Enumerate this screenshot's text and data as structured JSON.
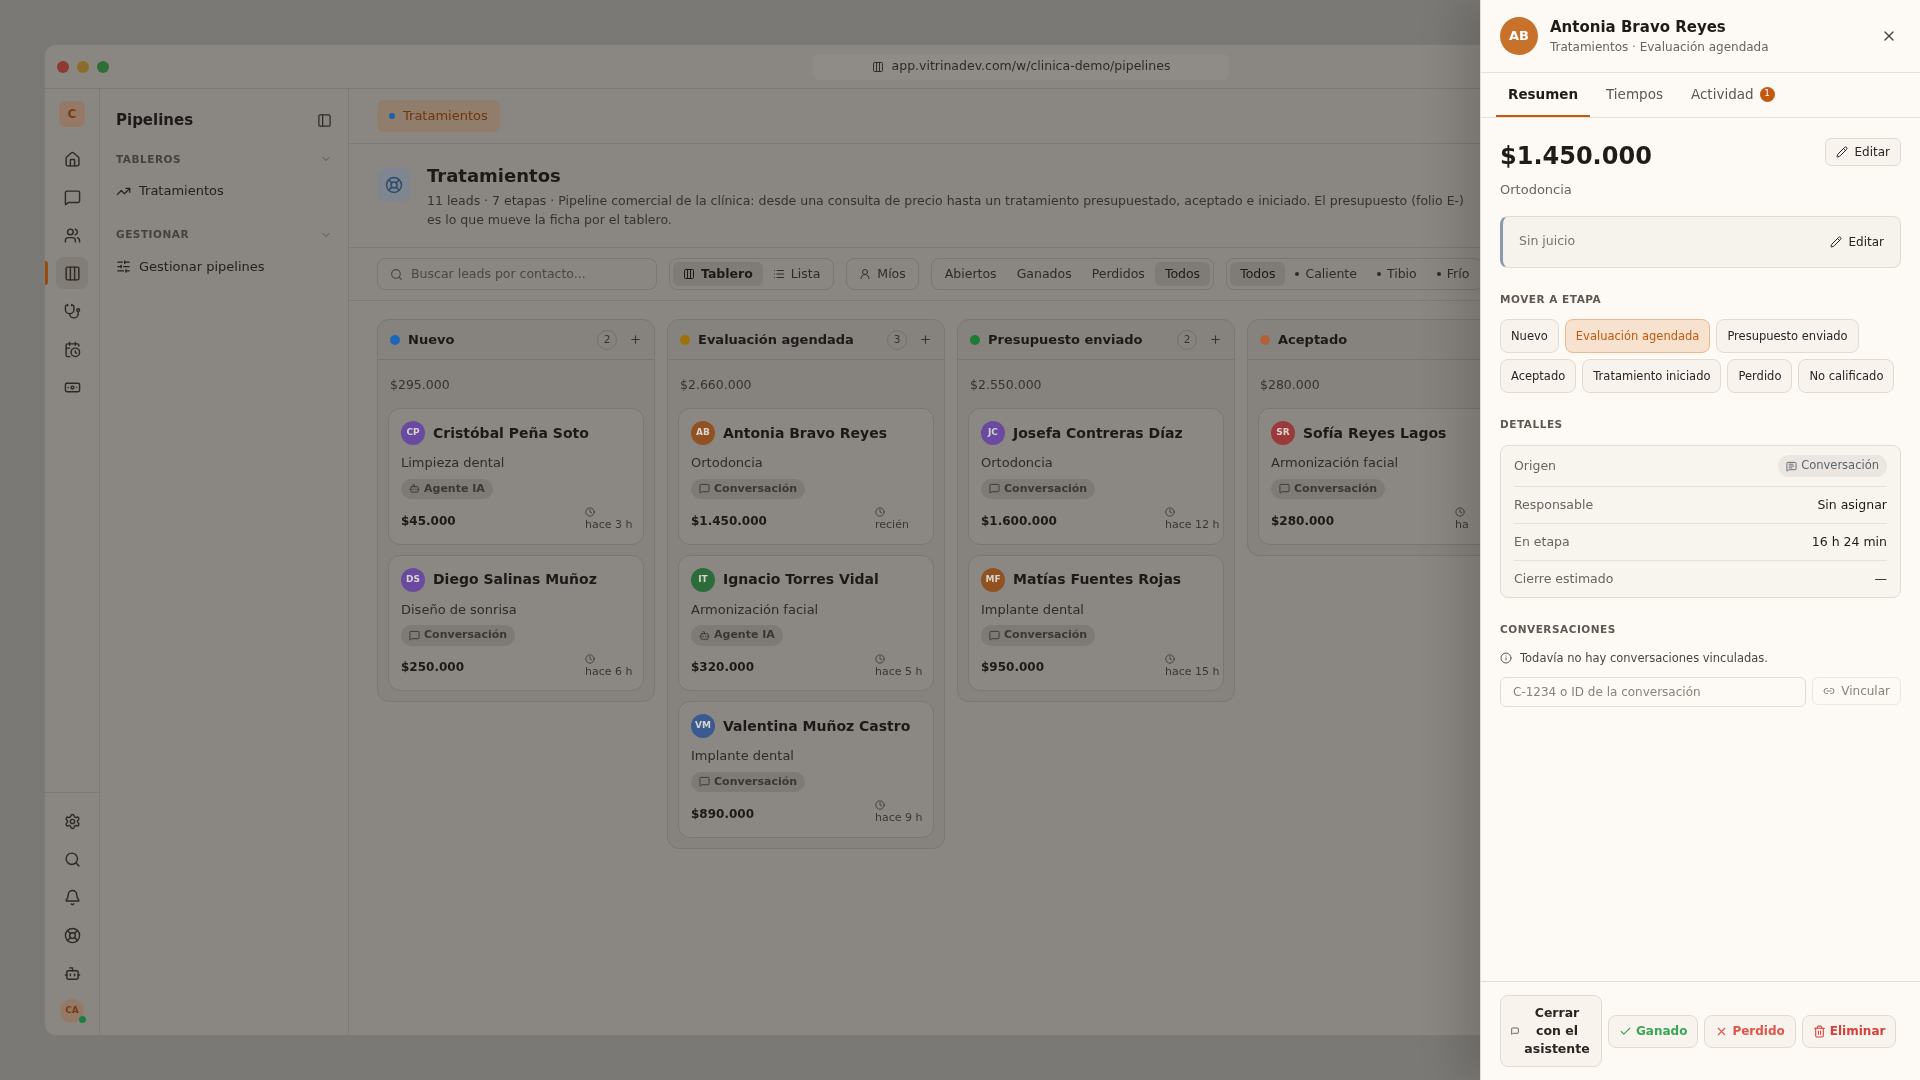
{
  "window": {
    "url": "app.vitrinadev.com/w/clinica-demo/pipelines"
  },
  "rail": {
    "logo": "C",
    "items": [
      {
        "kind": "home",
        "selected": false
      },
      {
        "kind": "chat",
        "selected": false
      },
      {
        "kind": "users",
        "selected": false
      },
      {
        "kind": "board",
        "selected": true
      },
      {
        "kind": "stethoscope",
        "selected": false
      },
      {
        "kind": "calendar",
        "selected": false
      },
      {
        "kind": "money",
        "selected": false
      }
    ],
    "bottom": [
      {
        "kind": "settings"
      },
      {
        "kind": "search"
      },
      {
        "kind": "bell"
      },
      {
        "kind": "help"
      },
      {
        "kind": "bot"
      }
    ],
    "avatar": "CA",
    "online": true
  },
  "sidebar": {
    "title": "Pipelines",
    "sections": [
      {
        "title": "TABLEROS",
        "items": [
          {
            "label": "Tratamientos",
            "kind": "trend"
          }
        ]
      },
      {
        "title": "GESTIONAR",
        "items": [
          {
            "label": "Gestionar pipelines",
            "kind": "sliders"
          }
        ]
      }
    ]
  },
  "tab_chip": "Tratamientos",
  "pipeline": {
    "title": "Tratamientos",
    "description": "11 leads · 7 etapas · Pipeline comercial de la clínica: desde una consulta de precio hasta un tratamiento presupuestado, aceptado e iniciado. El presupuesto (folio E-) es lo que mueve la ficha por el tablero."
  },
  "toolbar": {
    "search_placeholder": "Buscar leads por contacto...",
    "views": [
      {
        "label": "Tablero",
        "kind": "board",
        "selected": true
      },
      {
        "label": "Lista",
        "kind": "list",
        "selected": false
      }
    ],
    "mine": "Míos",
    "status_filters": [
      {
        "label": "Abiertos",
        "selected": false
      },
      {
        "label": "Ganados",
        "selected": false
      },
      {
        "label": "Perdidos",
        "selected": false
      },
      {
        "label": "Todos",
        "selected": true
      }
    ],
    "temperature_filters": [
      {
        "label": "Todos",
        "selected": true,
        "dot": false
      },
      {
        "label": "Caliente",
        "selected": false,
        "dot": true
      },
      {
        "label": "Tibio",
        "selected": false,
        "dot": true
      },
      {
        "label": "Frío",
        "selected": false,
        "dot": true
      }
    ]
  },
  "columns": [
    {
      "name": "Nuevo",
      "color": "#1f66b8",
      "count": "2",
      "total": "$295.000",
      "cards": [
        {
          "initials": "CP",
          "color": "#6a4aa0",
          "name": "Cristóbal Peña Soto",
          "treatment": "Limpieza dental",
          "source": "Agente IA",
          "kind": "agent",
          "amount": "$45.000",
          "time": "hace 3 h"
        },
        {
          "initials": "DS",
          "color": "#6a4aa0",
          "name": "Diego Salinas Muñoz",
          "treatment": "Diseño de sonrisa",
          "source": "Conversación",
          "kind": "chat",
          "amount": "$250.000",
          "time": "hace 6 h"
        }
      ]
    },
    {
      "name": "Evaluación agendada",
      "color": "#a0700a",
      "count": "3",
      "total": "$2.660.000",
      "cards": [
        {
          "initials": "AB",
          "color": "#8f5220",
          "name": "Antonia Bravo Reyes",
          "treatment": "Ortodoncia",
          "source": "Conversación",
          "kind": "chat",
          "amount": "$1.450.000",
          "time": "recién"
        },
        {
          "initials": "IT",
          "color": "#2c6b3a",
          "name": "Ignacio Torres Vidal",
          "treatment": "Armonización facial",
          "source": "Agente IA",
          "kind": "agent",
          "amount": "$320.000",
          "time": "hace 5 h"
        },
        {
          "initials": "VM",
          "color": "#3a5a90",
          "name": "Valentina Muñoz Castro",
          "treatment": "Implante dental",
          "source": "Conversación",
          "kind": "chat",
          "amount": "$890.000",
          "time": "hace 9 h"
        }
      ]
    },
    {
      "name": "Presupuesto enviado",
      "color": "#1f7a36",
      "count": "2",
      "total": "$2.550.000",
      "cards": [
        {
          "initials": "JC",
          "color": "#6a4aa0",
          "name": "Josefa Contreras Díaz",
          "treatment": "Ortodoncia",
          "source": "Conversación",
          "kind": "chat",
          "amount": "$1.600.000",
          "time": "hace 12 h"
        },
        {
          "initials": "MF",
          "color": "#8f5220",
          "name": "Matías Fuentes Rojas",
          "treatment": "Implante dental",
          "source": "Conversación",
          "kind": "chat",
          "amount": "$950.000",
          "time": "hace 15 h"
        }
      ]
    },
    {
      "name": "Aceptado",
      "color": "#b0613a",
      "total": "$280.000",
      "cards": [
        {
          "initials": "SR",
          "color": "#9a3a3a",
          "name": "Sofía Reyes Lagos",
          "treatment": "Armonización facial",
          "source": "Conversación",
          "kind": "chat",
          "amount": "$280.000",
          "time": "ha"
        }
      ]
    }
  ],
  "panel": {
    "initials": "AB",
    "name": "Antonia Bravo Reyes",
    "subtitle": "Tratamientos · Evaluación agendada",
    "tabs": [
      {
        "label": "Resumen",
        "selected": true
      },
      {
        "label": "Tiempos",
        "selected": false
      },
      {
        "label": "Actividad",
        "selected": false,
        "badge": "1"
      }
    ],
    "amount": "$1.450.000",
    "treatment": "Ortodoncia",
    "edit": "Editar",
    "note": "Sin juicio",
    "note_edit": "Editar",
    "move_title": "MOVER A ETAPA",
    "stages": [
      {
        "label": "Nuevo",
        "selected": false
      },
      {
        "label": "Evaluación agendada",
        "selected": true
      },
      {
        "label": "Presupuesto enviado",
        "selected": false
      },
      {
        "label": "Aceptado",
        "selected": false
      },
      {
        "label": "Tratamiento iniciado",
        "selected": false
      },
      {
        "label": "Perdido",
        "selected": false
      },
      {
        "label": "No calificado",
        "selected": false
      }
    ],
    "details_title": "DETALLES",
    "details": [
      {
        "label": "Origen",
        "value": "Conversación",
        "kind": "badge"
      },
      {
        "label": "Responsable",
        "value": "Sin asignar",
        "kind": "text"
      },
      {
        "label": "En etapa",
        "value": "16 h 24 min",
        "kind": "text"
      },
      {
        "label": "Cierre estimado",
        "value": "—",
        "kind": "text"
      }
    ],
    "conversations_title": "CONVERSACIONES",
    "conversations_empty": "Todavía no hay conversaciones vinculadas.",
    "link_placeholder": "C-1234 o ID de la conversación",
    "link_button": "Vincular",
    "actions": [
      {
        "label": "Cerrar con el asistente",
        "kind": "assistant"
      },
      {
        "label": "Ganado",
        "kind": "won"
      },
      {
        "label": "Perdido",
        "kind": "lost"
      },
      {
        "label": "Eliminar",
        "kind": "delete"
      }
    ]
  }
}
